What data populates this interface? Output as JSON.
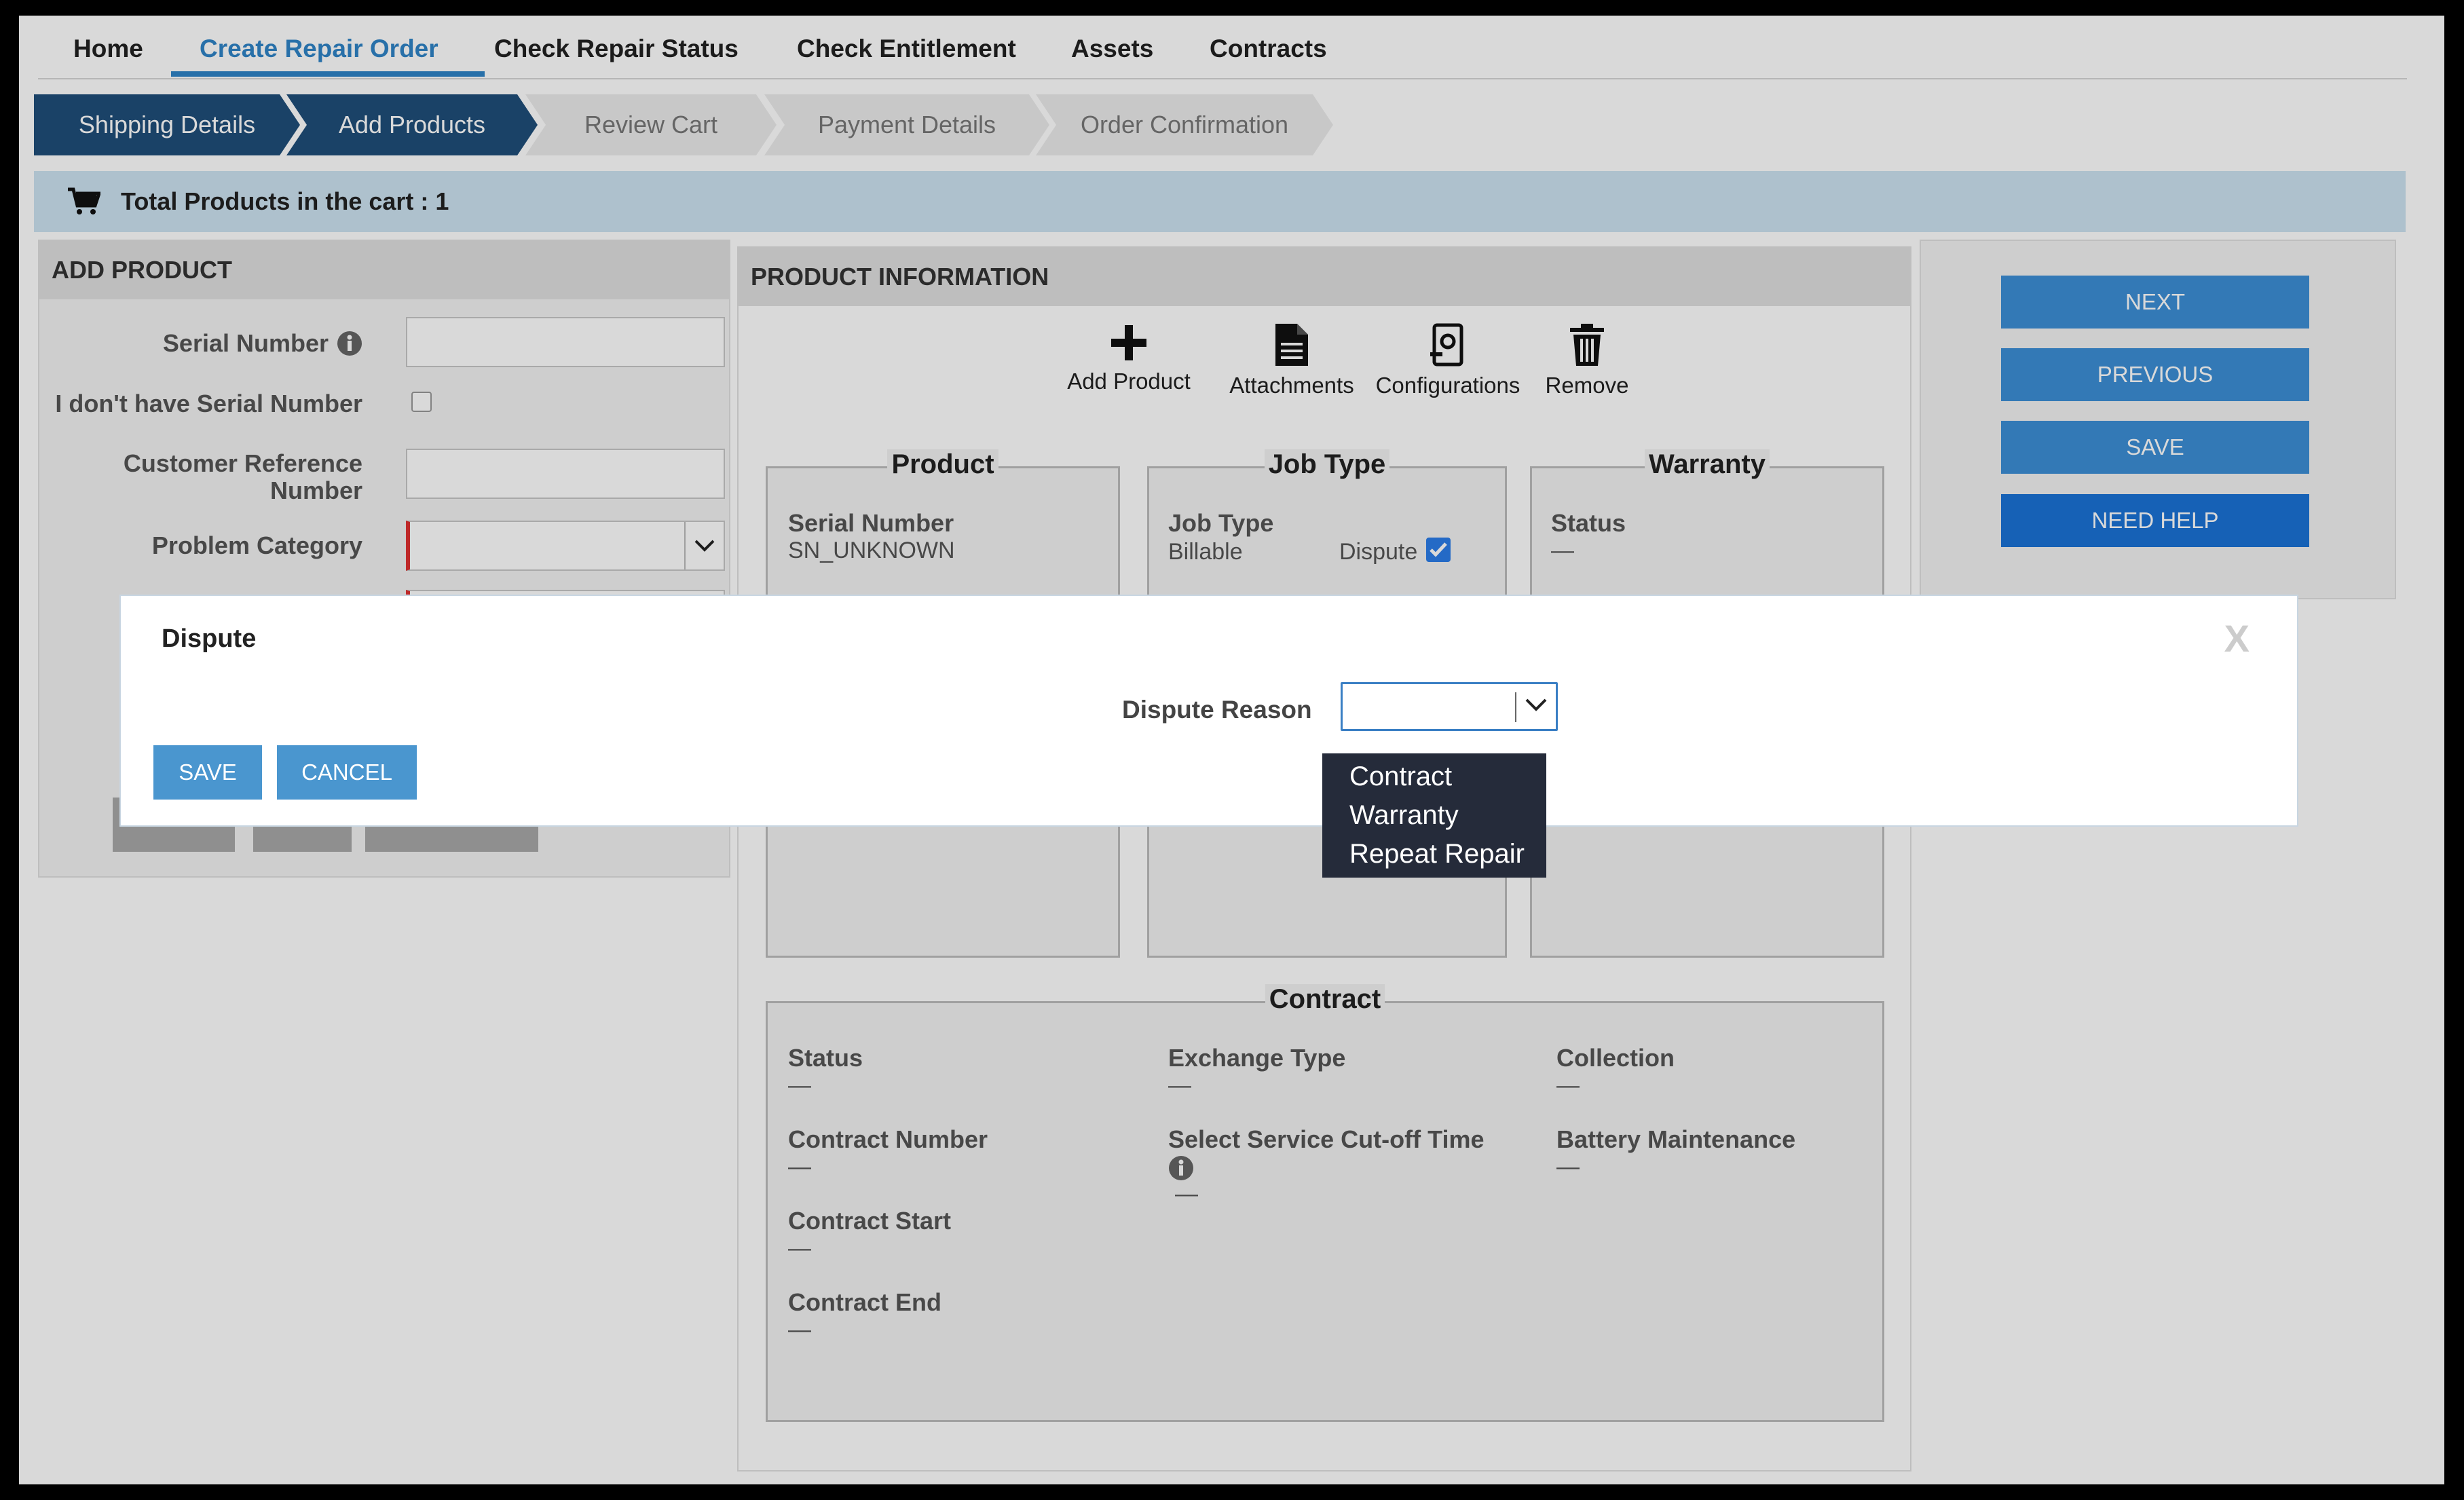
{
  "nav": {
    "items": [
      "Home",
      "Create Repair Order",
      "Check Repair Status",
      "Check Entitlement",
      "Assets",
      "Contracts"
    ],
    "active": "Create Repair Order"
  },
  "steps": [
    "Shipping Details",
    "Add Products",
    "Review Cart",
    "Payment Details",
    "Order Confirmation"
  ],
  "cart": {
    "text": "Total Products in the cart : 1"
  },
  "add_product": {
    "title": "ADD PRODUCT",
    "serial_label": "Serial Number",
    "no_serial_label": "I don't have Serial Number",
    "cust_ref_line1": "Customer Reference",
    "cust_ref_line2": "Number",
    "problem_category_label": "Problem Category"
  },
  "product_info": {
    "title": "PRODUCT INFORMATION",
    "tools": [
      "Add Product",
      "Attachments",
      "Configurations",
      "Remove"
    ],
    "product": {
      "legend": "Product",
      "serial_label": "Serial Number",
      "serial_value": "SN_UNKNOWN"
    },
    "job_type": {
      "legend": "Job Type",
      "label": "Job Type",
      "value": "Billable",
      "dispute_label": "Dispute",
      "dispute_checked": true
    },
    "warranty": {
      "legend": "Warranty",
      "status_label": "Status",
      "status_value": "—"
    },
    "contract": {
      "legend": "Contract",
      "status_label": "Status",
      "status_value": "—",
      "contract_number_label": "Contract Number",
      "contract_number_value": "—",
      "contract_start_label": "Contract Start",
      "contract_start_value": "—",
      "contract_end_label": "Contract End",
      "contract_end_value": "—",
      "exchange_type_label": "Exchange Type",
      "exchange_type_value": "—",
      "cutoff_label": "Select Service Cut-off Time",
      "cutoff_value": "—",
      "collection_label": "Collection",
      "collection_value": "—",
      "battery_label": "Battery Maintenance",
      "battery_value": "—"
    }
  },
  "actions": [
    "NEXT",
    "PREVIOUS",
    "SAVE",
    "NEED HELP"
  ],
  "modal": {
    "title": "Dispute",
    "close": "X",
    "reason_label": "Dispute Reason",
    "save": "SAVE",
    "cancel": "CANCEL",
    "options": [
      "Contract",
      "Warranty",
      "Repeat Repair"
    ]
  },
  "colors": {
    "accent": "#2f84c7",
    "step_done": "#1f4e79",
    "need_help": "#1b72d6",
    "required": "#e03030"
  }
}
